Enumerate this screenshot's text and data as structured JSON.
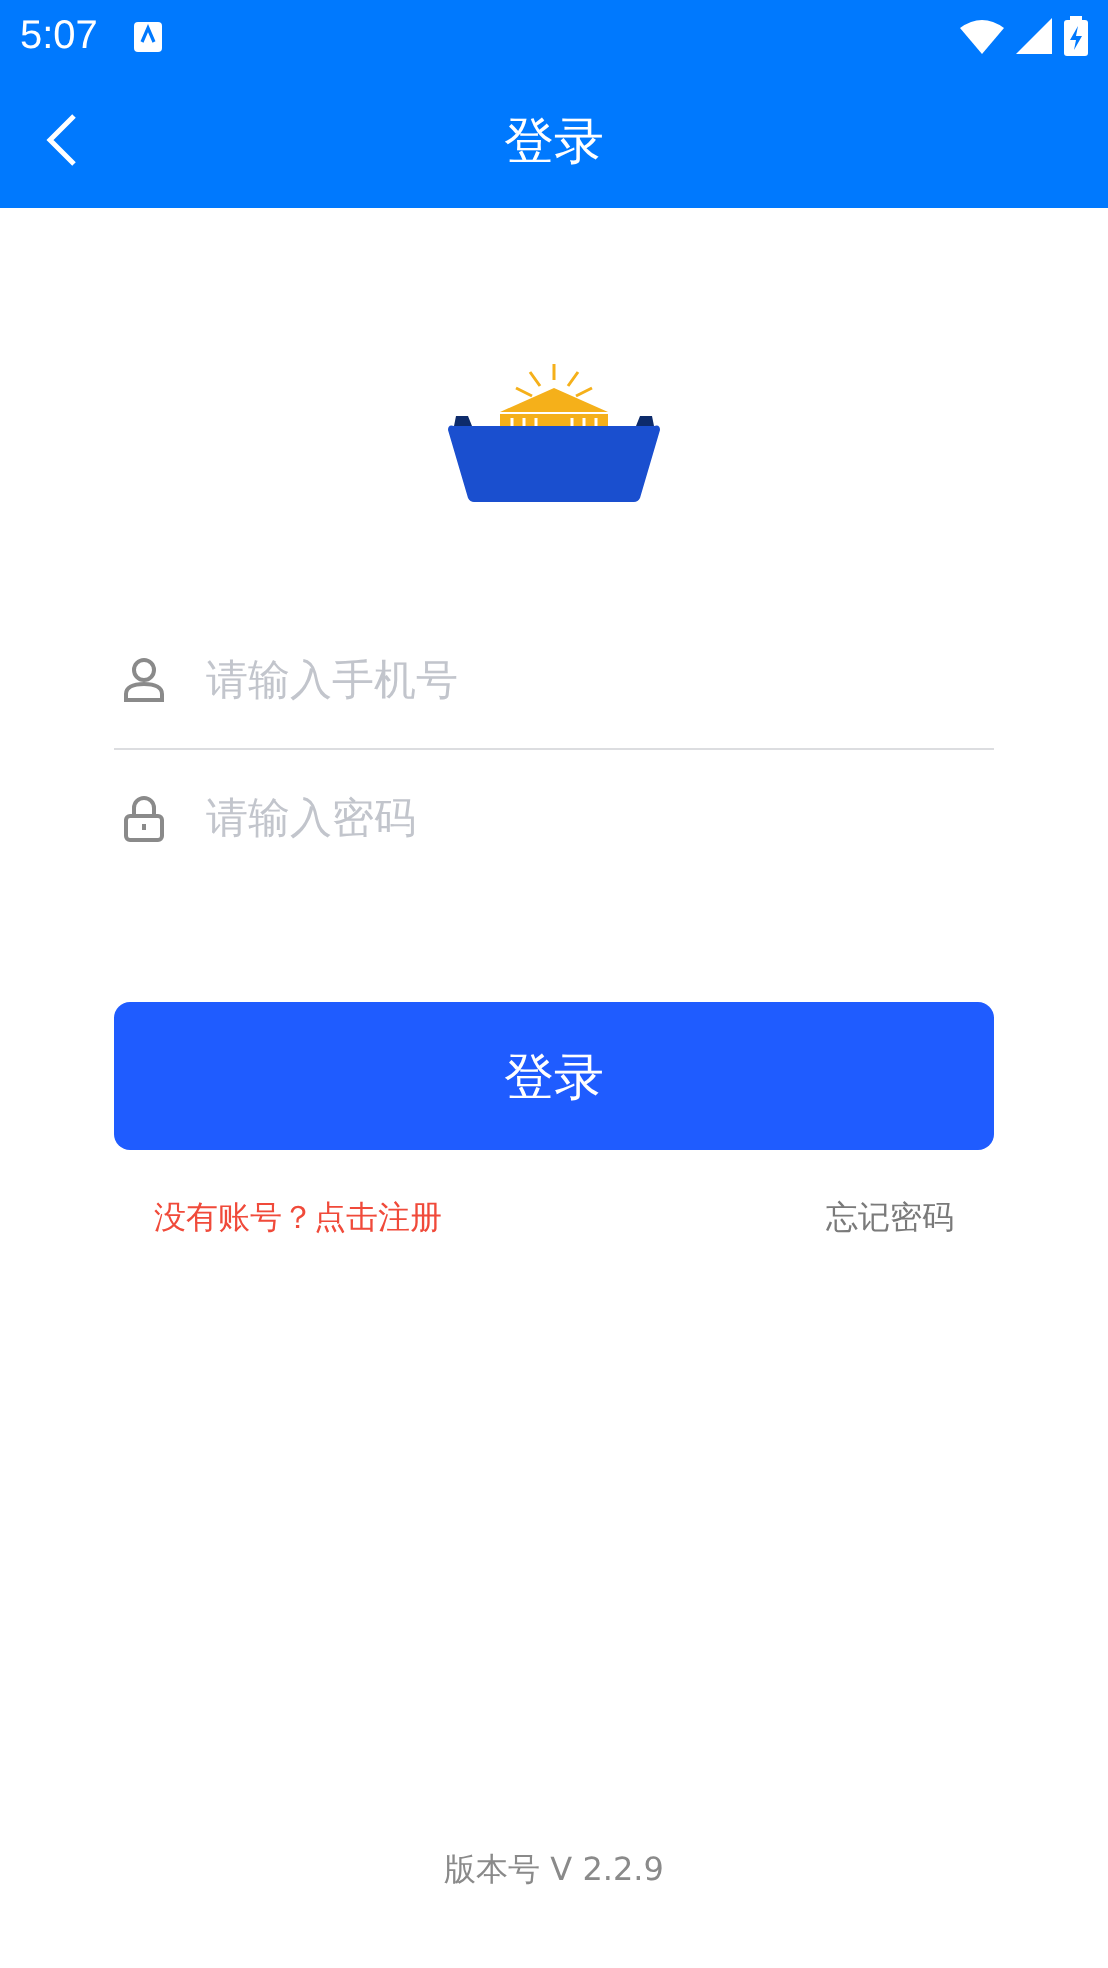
{
  "status_bar": {
    "time": "5:07"
  },
  "header": {
    "title": "登录"
  },
  "fields": [
    {
      "kind": "phone",
      "placeholder": "请输入手机号"
    },
    {
      "kind": "password",
      "placeholder": "请输入密码"
    }
  ],
  "login_button": "登录",
  "links": {
    "register": "没有账号？点击注册",
    "forgot": "忘记密码"
  },
  "version": "版本号 V 2.2.9"
}
